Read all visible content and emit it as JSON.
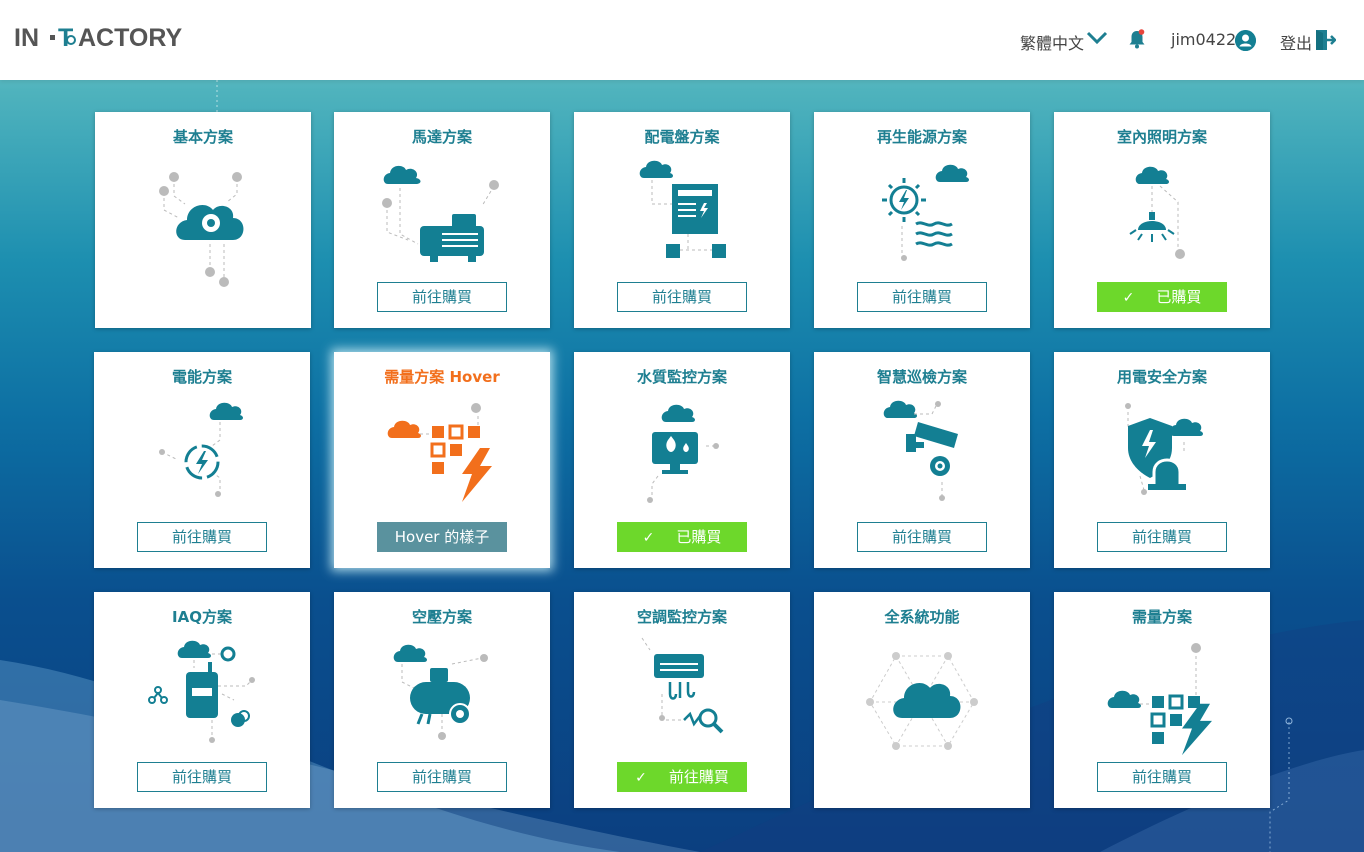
{
  "header": {
    "logo_text": "IN·FACTORY",
    "language": "繁體中文",
    "username": "jim0422",
    "logout": "登出"
  },
  "colors": {
    "brand_teal": "#1e7f91",
    "hover_orange": "#f26f1c",
    "purchased_green": "#6dd82b",
    "hover_button": "#5a929e"
  },
  "cards": [
    {
      "title": "基本方案",
      "icon": "cloud-gear-icon",
      "button": "",
      "state": "none"
    },
    {
      "title": "馬達方案",
      "icon": "motor-icon",
      "button": "前往購買",
      "state": "buy"
    },
    {
      "title": "配電盤方案",
      "icon": "distribution-panel-icon",
      "button": "前往購買",
      "state": "buy"
    },
    {
      "title": "再生能源方案",
      "icon": "renewable-energy-icon",
      "button": "前往購買",
      "state": "buy"
    },
    {
      "title": "室內照明方案",
      "icon": "ceiling-lamp-icon",
      "button": "已購買",
      "state": "bought"
    },
    {
      "title": "電能方案",
      "icon": "energy-cycle-icon",
      "button": "前往購買",
      "state": "buy"
    },
    {
      "title": "需量方案 Hover",
      "icon": "demand-grid-bolt-icon",
      "button": "Hover 的樣子",
      "state": "hover"
    },
    {
      "title": "水質監控方案",
      "icon": "water-monitor-icon",
      "button": "已購買",
      "state": "bought"
    },
    {
      "title": "智慧巡檢方案",
      "icon": "cctv-camera-icon",
      "button": "前往購買",
      "state": "buy"
    },
    {
      "title": "用電安全方案",
      "icon": "shield-alarm-icon",
      "button": "前往購買",
      "state": "buy"
    },
    {
      "title": "IAQ方案",
      "icon": "air-quality-icon",
      "button": "前往購買",
      "state": "buy"
    },
    {
      "title": "空壓方案",
      "icon": "air-compressor-icon",
      "button": "前往購買",
      "state": "buy"
    },
    {
      "title": "空調監控方案",
      "icon": "air-conditioner-icon",
      "button": "前往購買",
      "state": "bought"
    },
    {
      "title": "全系統功能",
      "icon": "cloud-network-icon",
      "button": "",
      "state": "none"
    },
    {
      "title": "需量方案",
      "icon": "demand-grid-bolt-icon",
      "button": "前往購買",
      "state": "buy"
    }
  ]
}
